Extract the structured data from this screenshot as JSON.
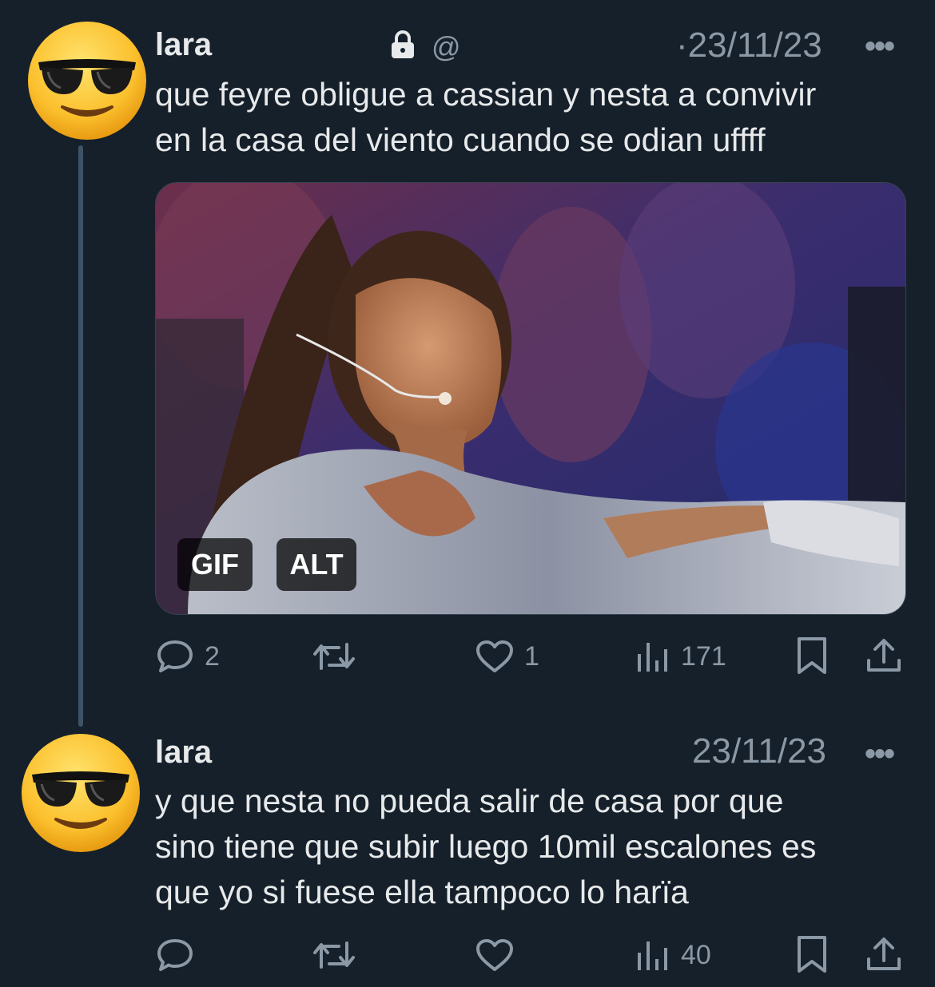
{
  "tweets": [
    {
      "display_name": "lara",
      "handle": "@",
      "date": "23/11/23",
      "date_prefix": "·",
      "more_label": "•••",
      "text_lines": [
        "que feyre obligue a cassian y nesta a convivir",
        "en la casa del viento cuando se odian uffff"
      ],
      "media": {
        "badges": [
          "GIF",
          "ALT"
        ]
      },
      "actions": {
        "replies": "2",
        "retweets": "",
        "likes": "1",
        "views": "171"
      }
    },
    {
      "display_name": "lara",
      "date": "23/11/23",
      "more_label": "•••",
      "text_lines": [
        "y que nesta no pueda salir de casa por que",
        "sino tiene que subir luego 10mil escalones es",
        "que yo si fuese ella tampoco lo harïa"
      ],
      "actions": {
        "replies": "",
        "retweets": "",
        "likes": "",
        "views": "40"
      }
    }
  ],
  "icons": {
    "avatar": "sunglasses-emoji",
    "protected": "lock-icon",
    "reply": "speech-bubble-icon",
    "retweet": "retweet-icon",
    "like": "heart-icon",
    "views": "bar-chart-icon",
    "bookmark": "bookmark-icon",
    "share": "share-icon"
  },
  "colors": {
    "background": "#15202b",
    "text": "#e7e9ea",
    "secondary": "#8b98a5",
    "thread_line": "#3d5466"
  }
}
